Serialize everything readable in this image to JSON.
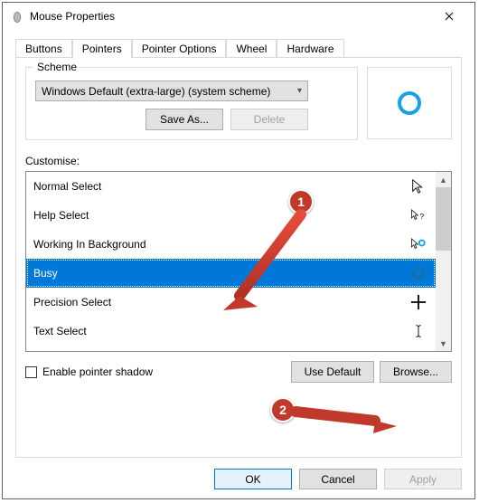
{
  "title": "Mouse Properties",
  "tabs": [
    "Buttons",
    "Pointers",
    "Pointer Options",
    "Wheel",
    "Hardware"
  ],
  "scheme": {
    "legend": "Scheme",
    "value": "Windows Default (extra-large) (system scheme)",
    "save_as": "Save As...",
    "delete": "Delete"
  },
  "customise_label": "Customise:",
  "list": [
    "Normal Select",
    "Help Select",
    "Working In Background",
    "Busy",
    "Precision Select",
    "Text Select"
  ],
  "selected_index": 3,
  "shadow_label": "Enable pointer shadow",
  "use_default": "Use Default",
  "browse": "Browse...",
  "footer": {
    "ok": "OK",
    "cancel": "Cancel",
    "apply": "Apply"
  },
  "annotations": [
    "1",
    "2"
  ],
  "colors": {
    "selection": "#0078d7",
    "accent_ring": "#1aa0e8",
    "badge": "#c0392b"
  }
}
